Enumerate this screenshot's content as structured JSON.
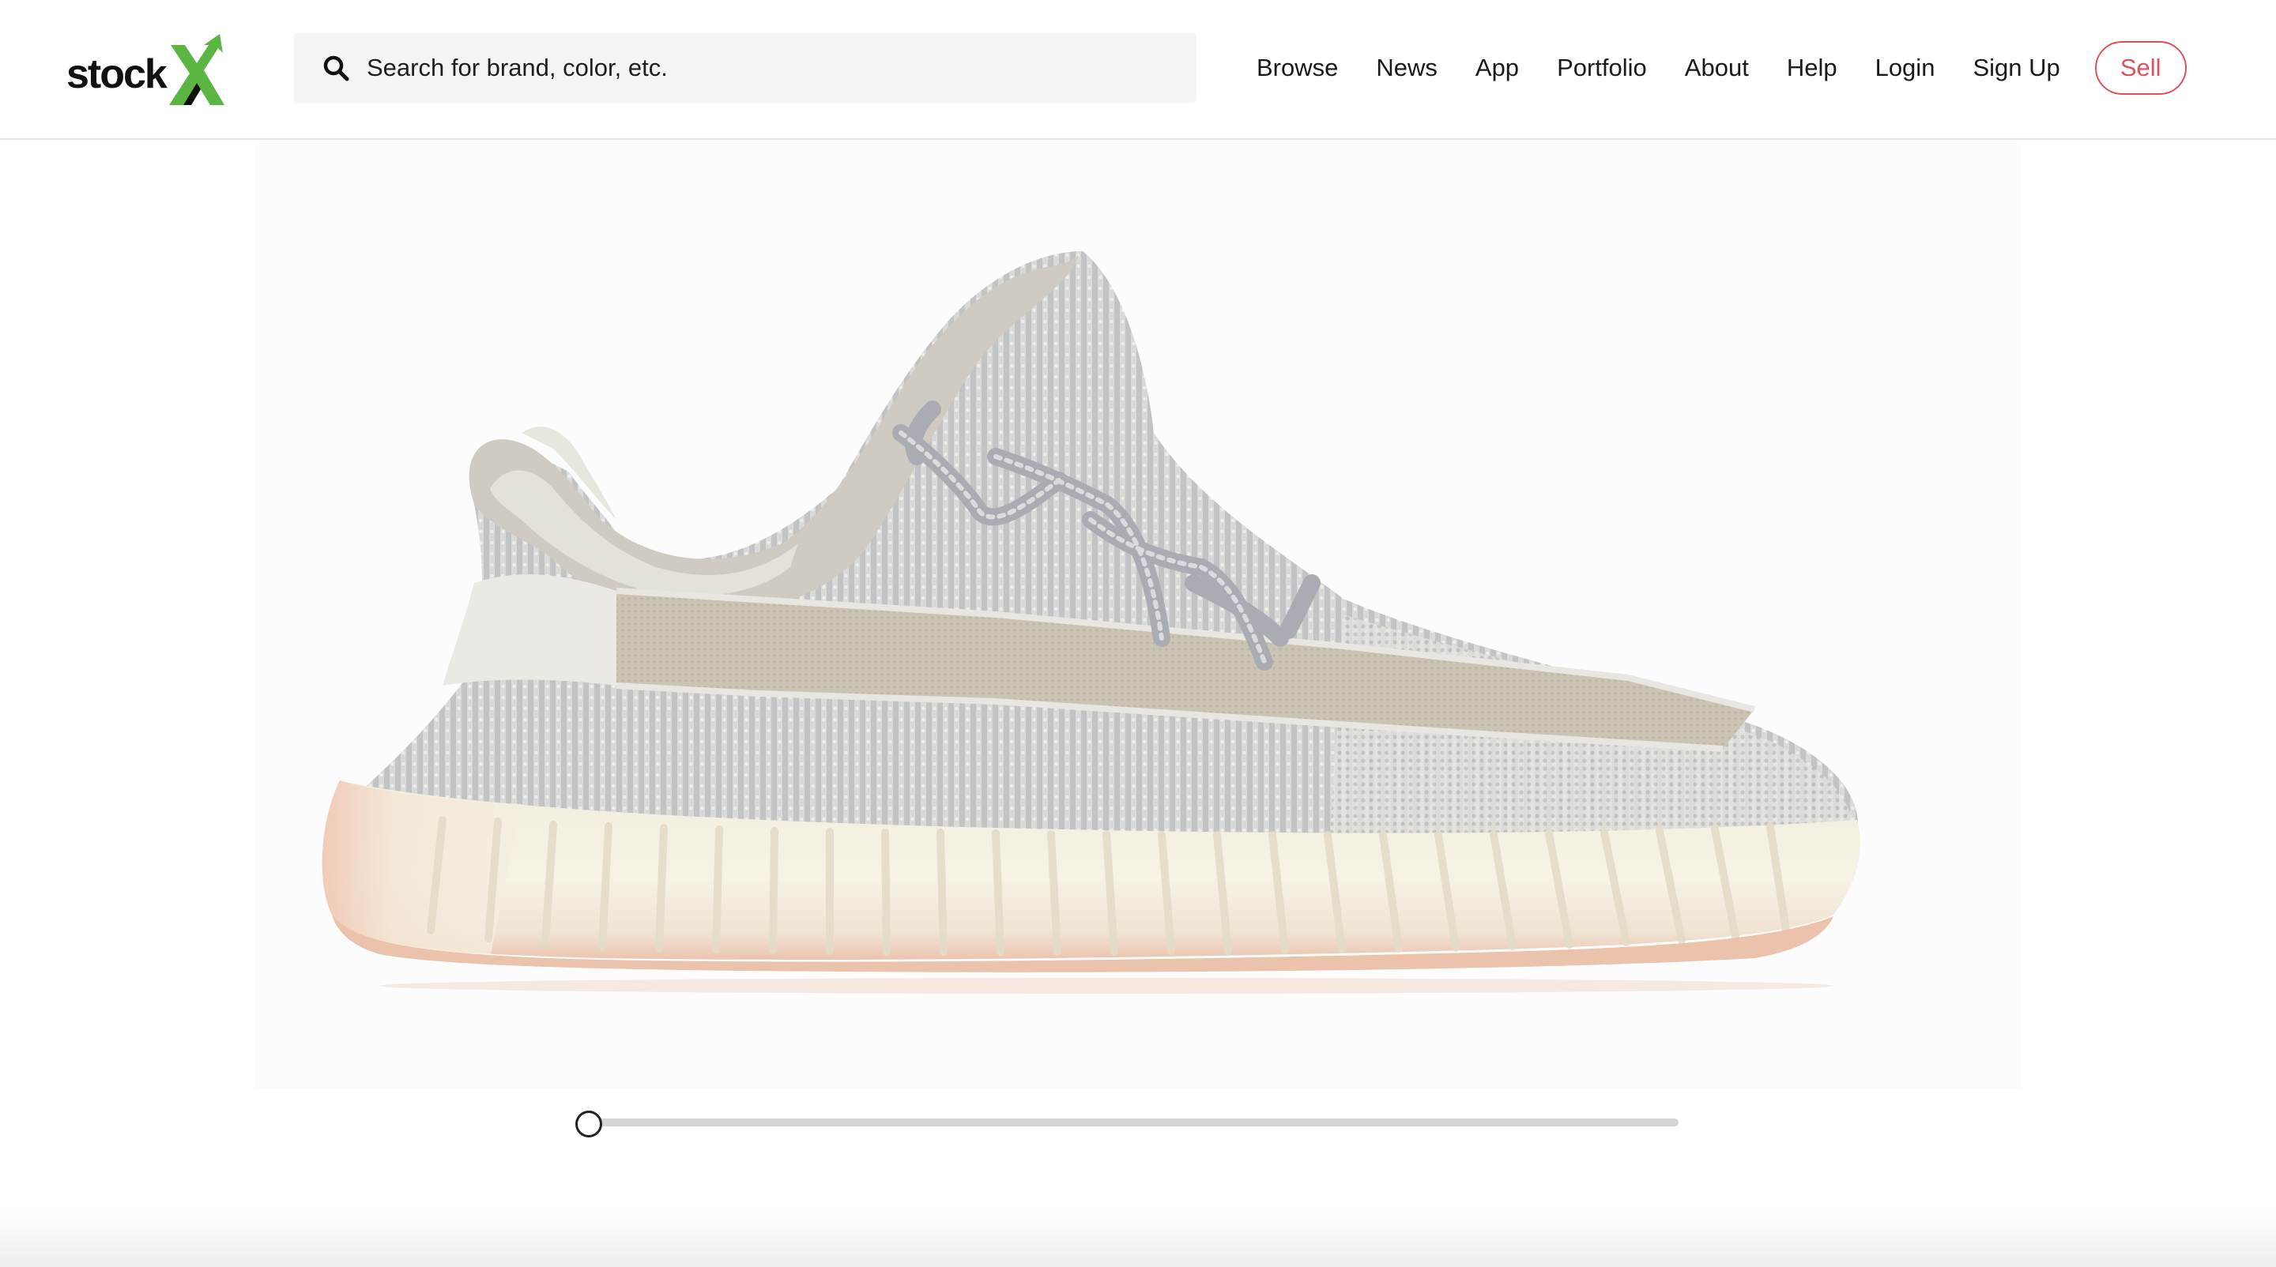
{
  "brand": {
    "logo_text": "stock",
    "logo_mark": "X",
    "accent_color": "#5bb543"
  },
  "search": {
    "placeholder": "Search for brand, color, etc.",
    "value": "",
    "icon": "search-icon"
  },
  "nav": {
    "items": [
      {
        "label": "Browse"
      },
      {
        "label": "News"
      },
      {
        "label": "App"
      },
      {
        "label": "Portfolio"
      },
      {
        "label": "About"
      },
      {
        "label": "Help"
      },
      {
        "label": "Login"
      },
      {
        "label": "Sign Up"
      }
    ],
    "sell_label": "Sell",
    "sell_color": "#e0505a"
  },
  "product": {
    "image_subject": "sneaker-side-view",
    "colors": {
      "knit": "#c9c9c7",
      "stripe": "#c4bcae",
      "sole": "#f3eddd",
      "sole_edge": "#eec1a9"
    }
  },
  "viewer": {
    "rotation_fraction": 0
  }
}
